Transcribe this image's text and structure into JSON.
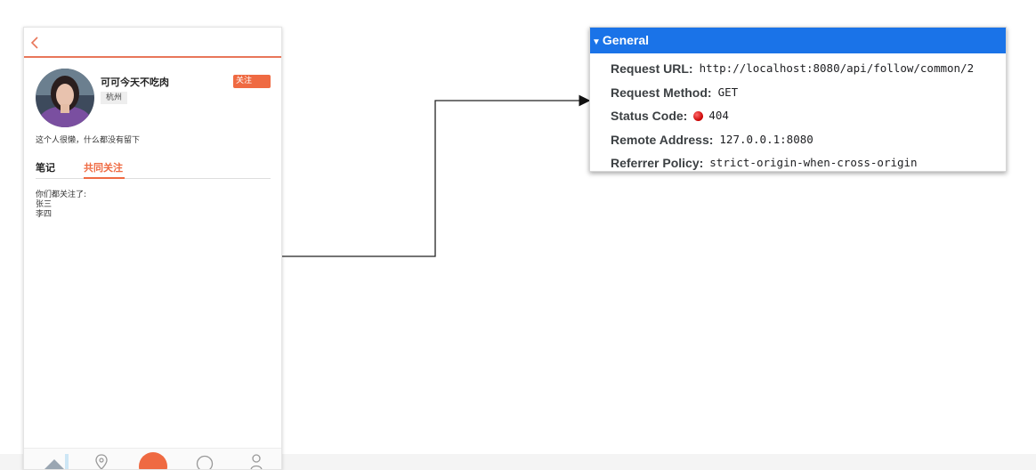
{
  "profile": {
    "name": "可可今天不吃肉",
    "location": "杭州",
    "follow_label": "关注",
    "bio": "这个人很懒，什么都没有留下",
    "avatar": "avatar-photo"
  },
  "tabs": [
    {
      "label": "笔记",
      "active": false
    },
    {
      "label": "共同关注",
      "active": true
    }
  ],
  "common_follows": {
    "heading": "你们都关注了:",
    "users": [
      "张三",
      "李四"
    ]
  },
  "bottom_nav": {
    "icons": [
      "home-icon",
      "map-pin-icon",
      "add-icon",
      "message-icon",
      "profile-icon"
    ]
  },
  "devtools": {
    "section_title": "General",
    "rows": [
      {
        "key": "Request URL:",
        "value": "http://localhost:8080/api/follow/common/2"
      },
      {
        "key": "Request Method:",
        "value": "GET"
      },
      {
        "key": "Status Code:",
        "value": "404",
        "status_color": "#d50000"
      },
      {
        "key": "Remote Address:",
        "value": "127.0.0.1:8080"
      },
      {
        "key": "Referrer Policy:",
        "value": "strict-origin-when-cross-origin"
      }
    ]
  },
  "colors": {
    "accent": "#ef6a42",
    "devtools_header": "#1a73e8"
  }
}
